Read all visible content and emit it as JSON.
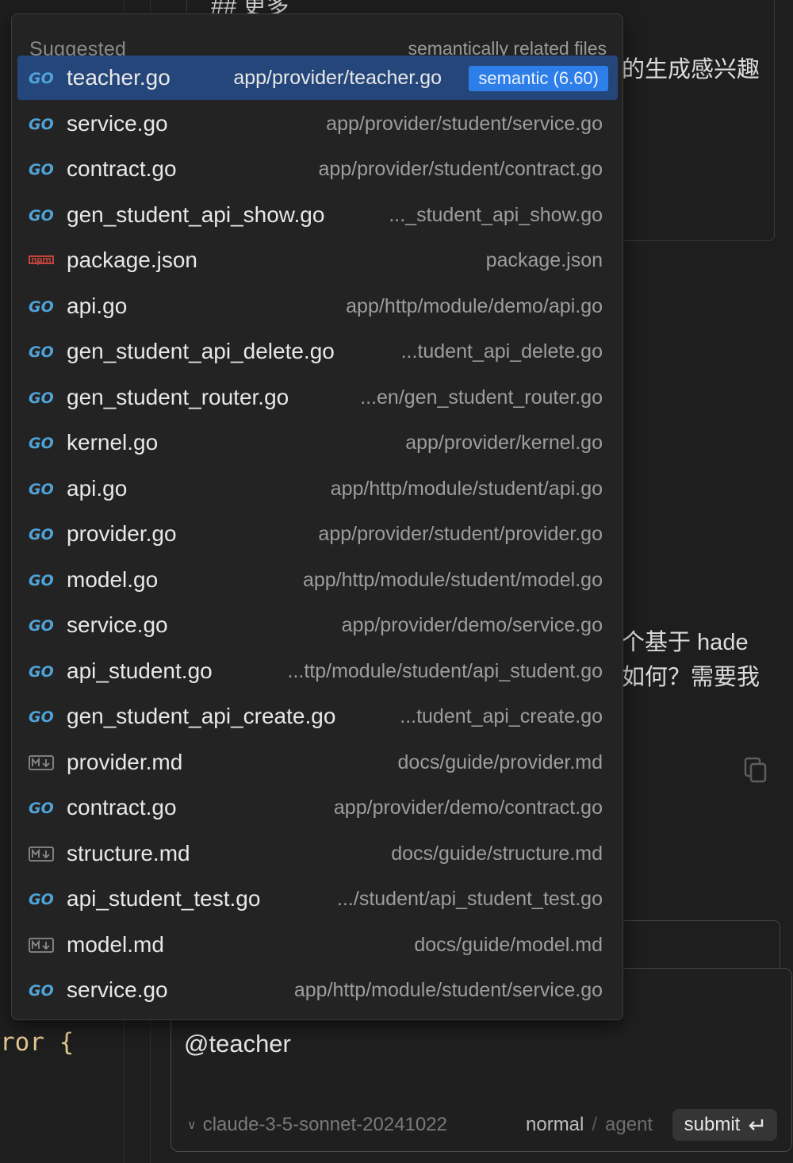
{
  "colors": {
    "background": "#1e1e1e",
    "popup_background": "#232323",
    "selected_row": "#25467a",
    "badge": "#2d7ee8",
    "go_icon": "#4fa3d8",
    "npm_icon": "#c4443b",
    "md_icon": "#8a8a8a"
  },
  "background": {
    "heading_fragment": "## 更多",
    "line_generate_interest": "的生成感兴趣",
    "line_hade": "个基于 hade",
    "line_how": "如何？需要我",
    "code_fragment": "ror {"
  },
  "popup": {
    "title": "Suggested",
    "subtitle": "semantically related files",
    "items": [
      {
        "icon": "go-icon",
        "name": "teacher.go",
        "path": "app/provider/teacher.go",
        "badge": "semantic (6.60)",
        "selected": true
      },
      {
        "icon": "go-icon",
        "name": "service.go",
        "path": "app/provider/student/service.go"
      },
      {
        "icon": "go-icon",
        "name": "contract.go",
        "path": "app/provider/student/contract.go"
      },
      {
        "icon": "go-icon",
        "name": "gen_student_api_show.go",
        "path": "..._student_api_show.go"
      },
      {
        "icon": "npm-icon",
        "name": "package.json",
        "path": "package.json"
      },
      {
        "icon": "go-icon",
        "name": "api.go",
        "path": "app/http/module/demo/api.go"
      },
      {
        "icon": "go-icon",
        "name": "gen_student_api_delete.go",
        "path": "...tudent_api_delete.go"
      },
      {
        "icon": "go-icon",
        "name": "gen_student_router.go",
        "path": "...en/gen_student_router.go"
      },
      {
        "icon": "go-icon",
        "name": "kernel.go",
        "path": "app/provider/kernel.go"
      },
      {
        "icon": "go-icon",
        "name": "api.go",
        "path": "app/http/module/student/api.go"
      },
      {
        "icon": "go-icon",
        "name": "provider.go",
        "path": "app/provider/student/provider.go"
      },
      {
        "icon": "go-icon",
        "name": "model.go",
        "path": "app/http/module/student/model.go"
      },
      {
        "icon": "go-icon",
        "name": "service.go",
        "path": "app/provider/demo/service.go"
      },
      {
        "icon": "go-icon",
        "name": "api_student.go",
        "path": "...ttp/module/student/api_student.go"
      },
      {
        "icon": "go-icon",
        "name": "gen_student_api_create.go",
        "path": "...tudent_api_create.go"
      },
      {
        "icon": "markdown-icon",
        "name": "provider.md",
        "path": "docs/guide/provider.md"
      },
      {
        "icon": "go-icon",
        "name": "contract.go",
        "path": "app/provider/demo/contract.go"
      },
      {
        "icon": "markdown-icon",
        "name": "structure.md",
        "path": "docs/guide/structure.md"
      },
      {
        "icon": "go-icon",
        "name": "api_student_test.go",
        "path": ".../student/api_student_test.go"
      },
      {
        "icon": "markdown-icon",
        "name": "model.md",
        "path": "docs/guide/model.md"
      },
      {
        "icon": "go-icon",
        "name": "service.go",
        "path": "app/http/module/student/service.go"
      }
    ]
  },
  "chat": {
    "input_value": "@teacher",
    "model": "claude-3-5-sonnet-20241022",
    "mode_normal": "normal",
    "mode_separator": "/",
    "mode_agent": "agent",
    "submit_label": "submit",
    "submit_icon": "enter-key-icon"
  }
}
